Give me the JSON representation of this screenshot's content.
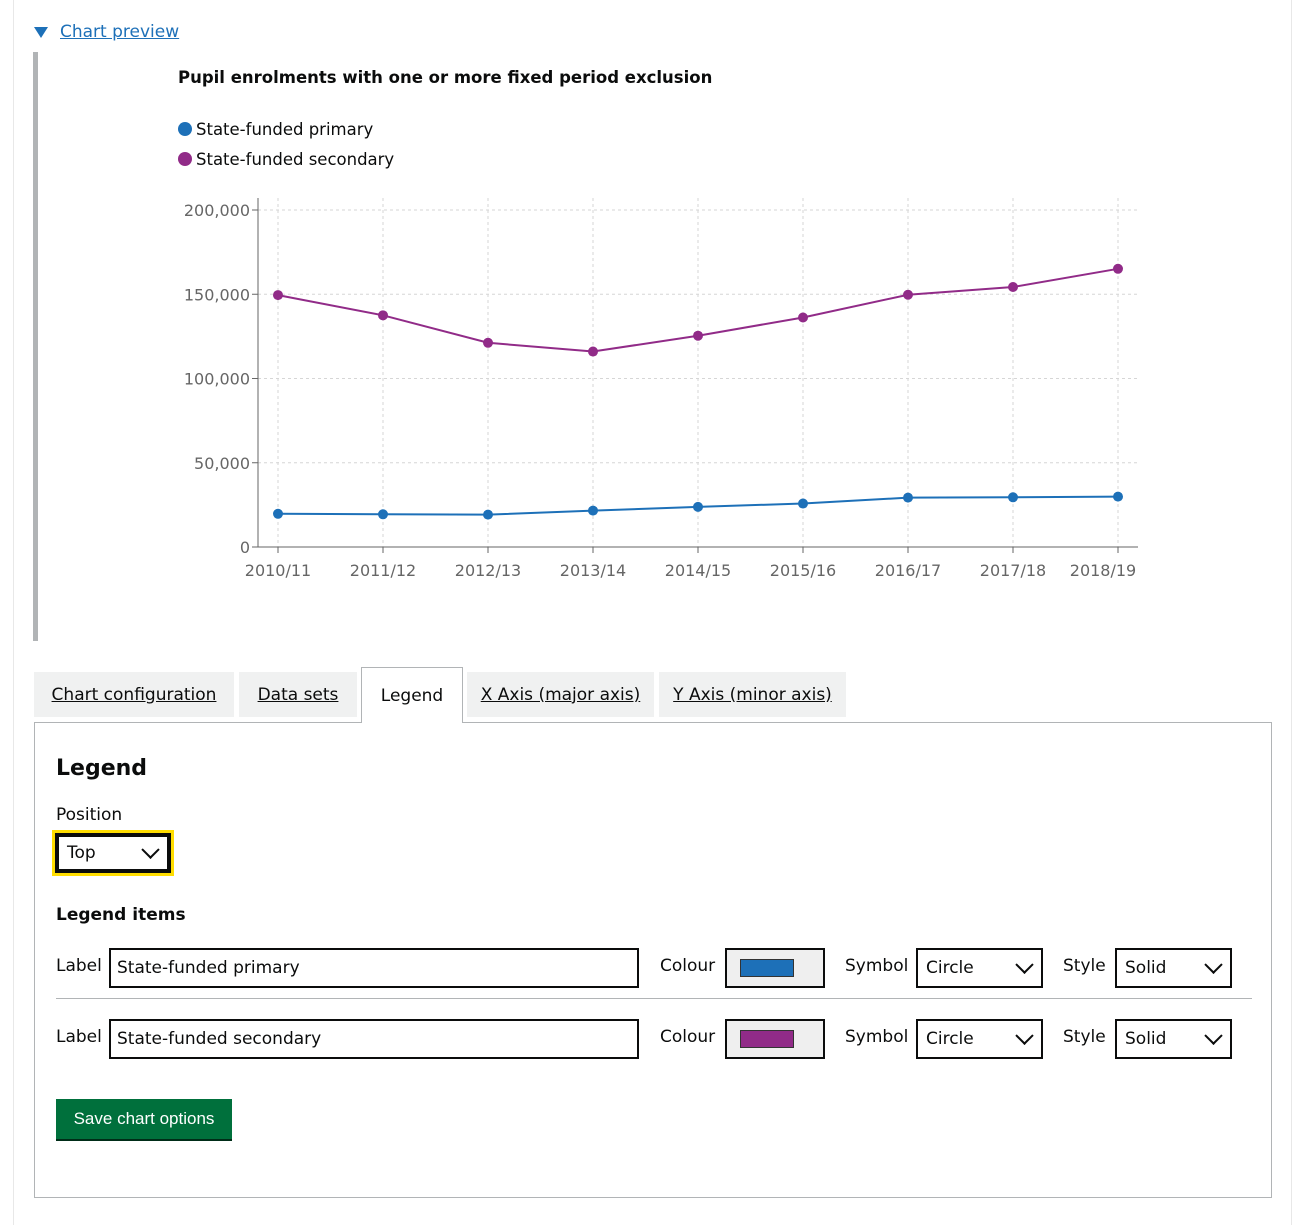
{
  "details": {
    "summary": "Chart preview"
  },
  "chart_data": {
    "type": "line",
    "title": "Pupil enrolments with one or more fixed period exclusion",
    "legend_position": "top",
    "categories": [
      "2010/11",
      "2011/12",
      "2012/13",
      "2013/14",
      "2014/15",
      "2015/16",
      "2016/17",
      "2017/18",
      "2018/19"
    ],
    "series": [
      {
        "name": "State-funded primary",
        "color": "#1d70b8",
        "values": [
          19700,
          19400,
          19200,
          21600,
          23800,
          25800,
          29300,
          29500,
          29900
        ]
      },
      {
        "name": "State-funded secondary",
        "color": "#912b88",
        "values": [
          149500,
          137500,
          121200,
          116000,
          125400,
          136200,
          149700,
          154300,
          165100
        ]
      }
    ],
    "ylim": [
      0,
      200000
    ],
    "y_ticks": [
      "0",
      "50,000",
      "100,000",
      "150,000",
      "200,000"
    ],
    "grid": true
  },
  "tabs": [
    {
      "label": "Chart configuration",
      "active": false
    },
    {
      "label": "Data sets",
      "active": false
    },
    {
      "label": "Legend",
      "active": true
    },
    {
      "label": "X Axis (major axis)",
      "active": false
    },
    {
      "label": "Y Axis (minor axis)",
      "active": false
    }
  ],
  "panel": {
    "title": "Legend",
    "position_label": "Position",
    "position_value": "Top",
    "items_heading": "Legend items",
    "items": [
      {
        "label_caption": "Label",
        "label_value": "State-funded primary",
        "colour_caption": "Colour",
        "colour": "#1d70b8",
        "symbol_caption": "Symbol",
        "symbol": "Circle",
        "style_caption": "Style",
        "style": "Solid"
      },
      {
        "label_caption": "Label",
        "label_value": "State-funded secondary",
        "colour_caption": "Colour",
        "colour": "#912b88",
        "symbol_caption": "Symbol",
        "symbol": "Circle",
        "style_caption": "Style",
        "style": "Solid"
      }
    ],
    "save_label": "Save chart options"
  }
}
